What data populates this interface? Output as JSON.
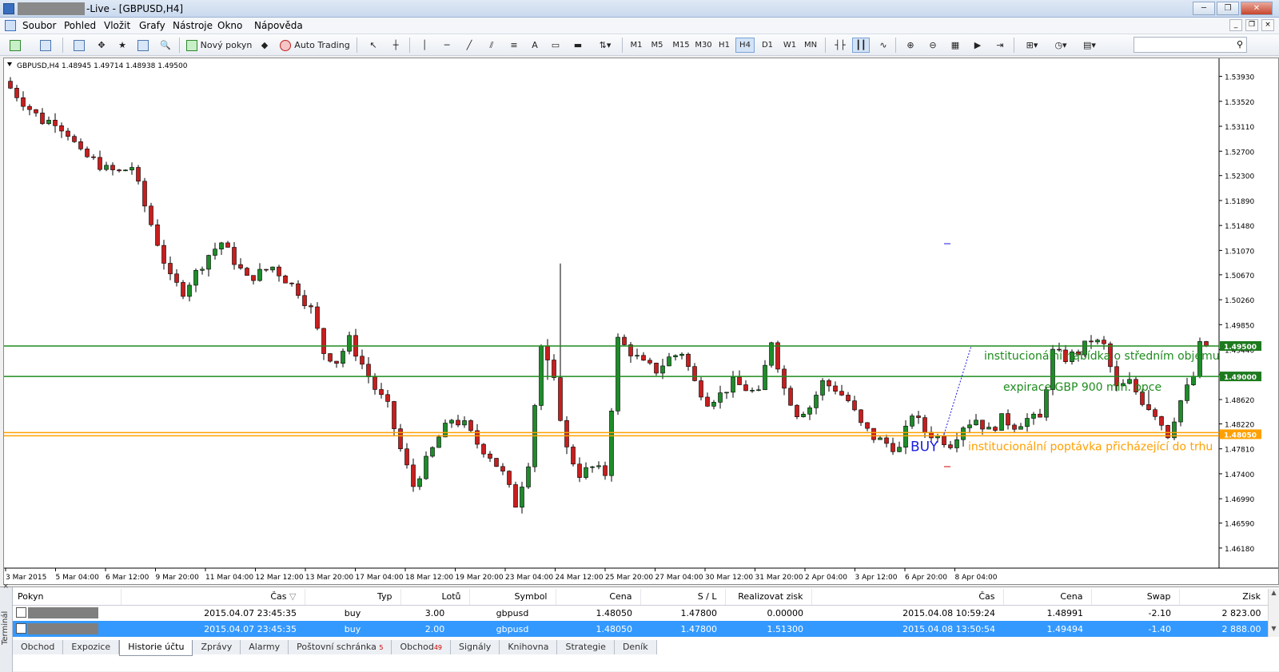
{
  "window": {
    "title": "-Live - [GBPUSD,H4]",
    "controls": {
      "minimize": "─",
      "maximize": "❐",
      "close": "✕"
    }
  },
  "menu": [
    "Soubor",
    "Pohled",
    "Vložit",
    "Grafy",
    "Nástroje",
    "Okno",
    "Nápověda"
  ],
  "toolbar": {
    "new_order": "Nový pokyn",
    "auto_trading": "Auto Trading",
    "text_tool": "A",
    "timeframes": [
      "M1",
      "M5",
      "M15",
      "M30",
      "H1",
      "H4",
      "D1",
      "W1",
      "MN"
    ],
    "active_timeframe": "H4",
    "search_placeholder": ""
  },
  "chart": {
    "info": "GBPUSD,H4  1.48945 1.49714 1.48938 1.49500",
    "annotations": {
      "upper": "institucionální nabídka o středním objemu",
      "middle": "expirace GBP 900 mln. opce",
      "buy": "BUY",
      "lower": "institucionální poptávka přicházející do trhu"
    },
    "price_markers": {
      "l1": "1.49500",
      "l2": "1.49000",
      "l3": "1.48050"
    },
    "colors": {
      "bull": "#1e8c2a",
      "bear": "#c81e1e",
      "green_line": "#1e8c1e",
      "orange_line": "#ffa000",
      "buy": "#1a1ae0"
    }
  },
  "chart_data": {
    "type": "candlestick",
    "symbol": "GBPUSD",
    "timeframe": "H4",
    "ylim": [
      1.4585,
      1.542
    ],
    "yticks": [
      "1.53930",
      "1.53520",
      "1.53110",
      "1.52700",
      "1.52300",
      "1.51890",
      "1.51480",
      "1.51070",
      "1.50670",
      "1.50260",
      "1.49850",
      "1.49440",
      "1.49030",
      "1.48620",
      "1.48220",
      "1.47810",
      "1.47400",
      "1.46990",
      "1.46590",
      "1.46180"
    ],
    "xticks": [
      "3 Mar 2015",
      "5 Mar 04:00",
      "6 Mar 12:00",
      "9 Mar 20:00",
      "11 Mar 04:00",
      "12 Mar 12:00",
      "13 Mar 20:00",
      "17 Mar 04:00",
      "18 Mar 12:00",
      "19 Mar 20:00",
      "23 Mar 04:00",
      "24 Mar 12:00",
      "25 Mar 20:00",
      "27 Mar 04:00",
      "30 Mar 12:00",
      "31 Mar 20:00",
      "2 Apr 04:00",
      "3 Apr 12:00",
      "6 Apr 20:00",
      "8 Apr 04:00"
    ],
    "levels": [
      1.495,
      1.49,
      1.4805
    ],
    "anchors": [
      [
        0,
        1.5385
      ],
      [
        4,
        1.534
      ],
      [
        6,
        1.532
      ],
      [
        8,
        1.532
      ],
      [
        10,
        1.53
      ],
      [
        12,
        1.5265
      ],
      [
        14,
        1.5255
      ],
      [
        16,
        1.524
      ],
      [
        18,
        1.5235
      ],
      [
        20,
        1.5245
      ],
      [
        22,
        1.518
      ],
      [
        24,
        1.512
      ],
      [
        26,
        1.506
      ],
      [
        28,
        1.504
      ],
      [
        30,
        1.507
      ],
      [
        32,
        1.51
      ],
      [
        34,
        1.512
      ],
      [
        36,
        1.509
      ],
      [
        38,
        1.506
      ],
      [
        40,
        1.507
      ],
      [
        42,
        1.508
      ],
      [
        44,
        1.506
      ],
      [
        46,
        1.504
      ],
      [
        48,
        1.501
      ],
      [
        50,
        1.494
      ],
      [
        52,
        1.4925
      ],
      [
        54,
        1.496
      ],
      [
        56,
        1.492
      ],
      [
        58,
        1.488
      ],
      [
        60,
        1.485
      ],
      [
        62,
        1.478
      ],
      [
        64,
        1.472
      ],
      [
        66,
        1.476
      ],
      [
        68,
        1.48
      ],
      [
        70,
        1.483
      ],
      [
        72,
        1.482
      ],
      [
        74,
        1.479
      ],
      [
        76,
        1.477
      ],
      [
        78,
        1.474
      ],
      [
        80,
        1.469
      ],
      [
        82,
        1.476
      ],
      [
        84,
        1.495
      ],
      [
        86,
        1.489
      ],
      [
        88,
        1.478
      ],
      [
        90,
        1.474
      ],
      [
        92,
        1.475
      ],
      [
        94,
        1.474
      ],
      [
        96,
        1.496
      ],
      [
        98,
        1.494
      ],
      [
        100,
        1.492
      ],
      [
        102,
        1.491
      ],
      [
        104,
        1.493
      ],
      [
        106,
        1.494
      ],
      [
        108,
        1.489
      ],
      [
        110,
        1.486
      ],
      [
        112,
        1.487
      ],
      [
        114,
        1.489
      ],
      [
        116,
        1.488
      ],
      [
        118,
        1.487
      ],
      [
        120,
        1.496
      ],
      [
        122,
        1.488
      ],
      [
        124,
        1.484
      ],
      [
        126,
        1.485
      ],
      [
        128,
        1.489
      ],
      [
        130,
        1.488
      ],
      [
        132,
        1.486
      ],
      [
        134,
        1.482
      ],
      [
        136,
        1.48
      ],
      [
        138,
        1.479
      ],
      [
        140,
        1.478
      ],
      [
        142,
        1.484
      ],
      [
        144,
        1.481
      ],
      [
        146,
        1.48
      ],
      [
        148,
        1.479
      ],
      [
        150,
        1.482
      ],
      [
        152,
        1.483
      ],
      [
        154,
        1.481
      ],
      [
        156,
        1.483
      ],
      [
        158,
        1.482
      ],
      [
        160,
        1.483
      ],
      [
        162,
        1.483
      ],
      [
        164,
        1.494
      ],
      [
        166,
        1.493
      ],
      [
        168,
        1.494
      ],
      [
        170,
        1.496
      ],
      [
        172,
        1.495
      ],
      [
        174,
        1.488
      ],
      [
        176,
        1.489
      ],
      [
        178,
        1.486
      ],
      [
        180,
        1.484
      ],
      [
        182,
        1.4805
      ],
      [
        184,
        1.486
      ],
      [
        186,
        1.49
      ],
      [
        187,
        1.495
      ]
    ]
  },
  "terminal": {
    "label": "Terminál",
    "columns": [
      "Pokyn",
      "Čas",
      "Typ",
      "Lotů",
      "Symbol",
      "Cena",
      "S / L",
      "Realizovat zisk",
      "Čas",
      "Cena",
      "Swap",
      "Zisk"
    ],
    "rows": [
      [
        "",
        "2015.04.07 23:45:35",
        "buy",
        "3.00",
        "gbpusd",
        "1.48050",
        "1.47800",
        "0.00000",
        "2015.04.08 10:59:24",
        "1.48991",
        "-2.10",
        "2 823.00"
      ],
      [
        "",
        "2015.04.07 23:45:35",
        "buy",
        "2.00",
        "gbpusd",
        "1.48050",
        "1.47800",
        "1.51300",
        "2015.04.08 13:50:54",
        "1.49494",
        "-1.40",
        "2 888.00"
      ]
    ],
    "tabs": [
      "Obchod",
      "Expozice",
      "Historie účtu",
      "Zprávy",
      "Alarmy",
      "Poštovní schránka",
      "Obchod",
      "Signály",
      "Knihovna",
      "Strategie",
      "Deník"
    ],
    "badges": {
      "mailbox": "5",
      "market": "49"
    },
    "active_tab": "Historie účtu"
  }
}
